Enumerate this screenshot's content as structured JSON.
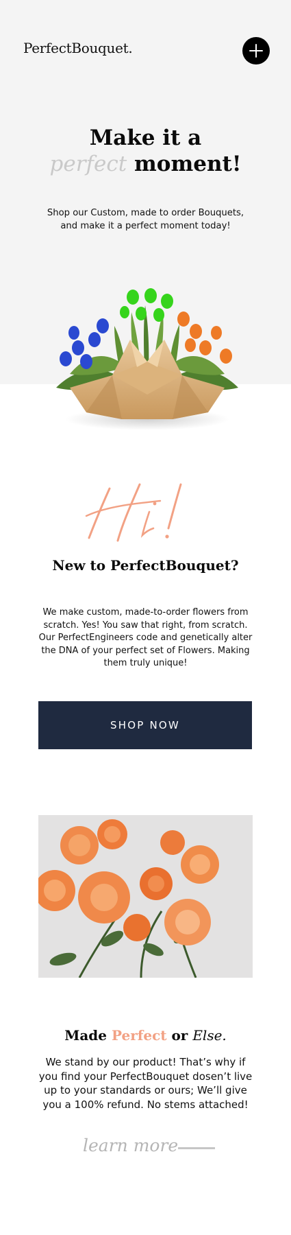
{
  "header": {
    "logo": "PerfectBouquet.",
    "menu_icon": "plus-icon"
  },
  "hero": {
    "title_line1": "Make it a",
    "title_accent": "perfect",
    "title_line2_rest": "moment!",
    "subtitle": "Shop our Custom, made to order Bouquets, and make it a perfect moment today!"
  },
  "intro": {
    "greeting": "Hi!",
    "title": "New to PerfectBouquet?",
    "body": "We make custom, made-to-order flowers from scratch. Yes! You saw that right, from scratch. Our PerfectEngineers code and genetically alter the DNA of your perfect set of Flowers. Making them truly unique!",
    "cta_label": "SHOP NOW"
  },
  "guarantee": {
    "title_made": "Made",
    "title_perfect": "Perfect",
    "title_or": "or",
    "title_else": "Else.",
    "body": "We stand by our product! That’s why if you find your PerfectBouquet dosen’t live up to your standards or ours; We’ll give you a 100% refund. No stems attached!",
    "link_label": "learn more"
  },
  "colors": {
    "hero_bg": "#f4f4f4",
    "accent_pink": "#f2a184",
    "button_navy": "#1f2a40"
  }
}
